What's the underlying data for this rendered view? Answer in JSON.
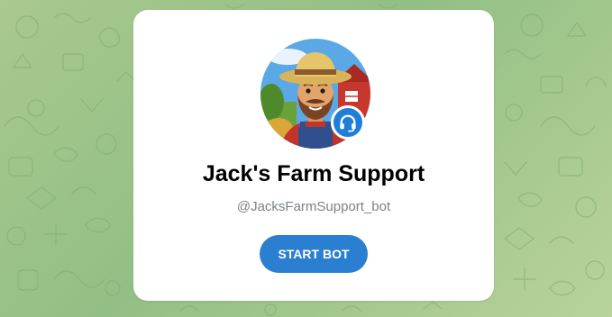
{
  "bot": {
    "name": "Jack's Farm Support",
    "username": "@JacksFarmSupport_bot",
    "avatar_icon": "farmer-avatar-icon",
    "badge_icon": "headset-icon"
  },
  "actions": {
    "start_label": "START BOT"
  },
  "colors": {
    "background": "#9fc58c",
    "card": "#ffffff",
    "button": "#2b7fd0",
    "button_text": "#ffffff",
    "title": "#000000",
    "username": "#7c8187",
    "badge": "#1f7fd8"
  }
}
